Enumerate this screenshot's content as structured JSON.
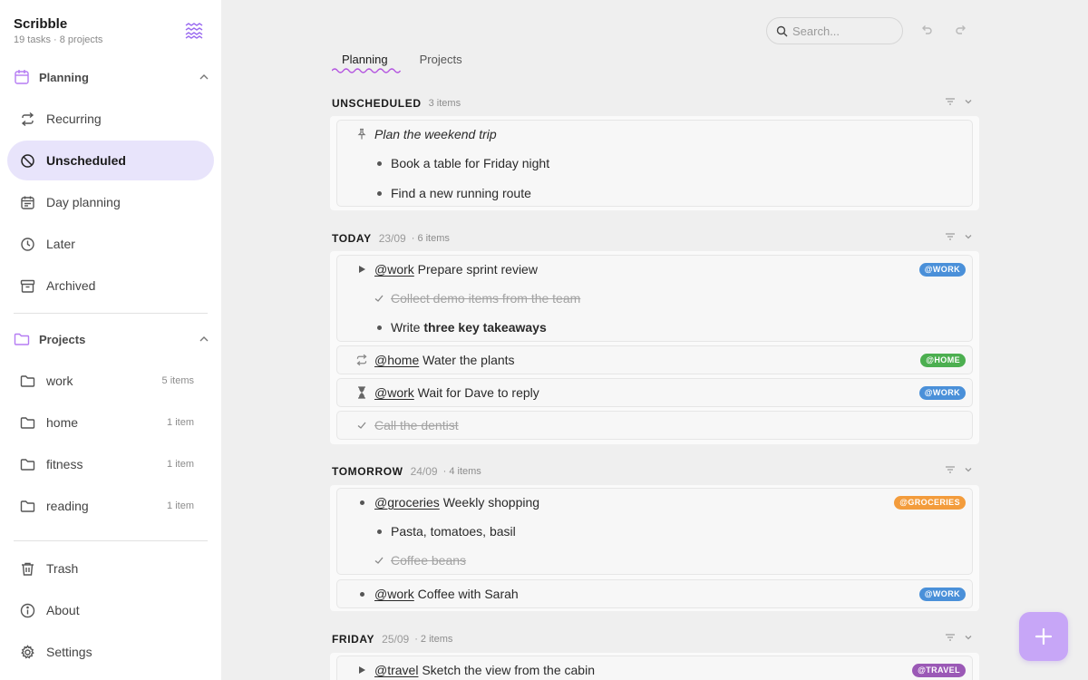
{
  "app": {
    "name": "Scribble",
    "summary": "19 tasks · 8 projects"
  },
  "sidebar": {
    "planning_label": "Planning",
    "planning_items": [
      {
        "label": "Recurring",
        "icon": "repeat-icon"
      },
      {
        "label": "Unscheduled",
        "icon": "unscheduled-icon",
        "active": true
      },
      {
        "label": "Day planning",
        "icon": "calendar-icon"
      },
      {
        "label": "Later",
        "icon": "clock-icon"
      },
      {
        "label": "Archived",
        "icon": "archive-icon"
      }
    ],
    "projects_label": "Projects",
    "projects": [
      {
        "label": "work",
        "count": "5 items"
      },
      {
        "label": "home",
        "count": "1 item"
      },
      {
        "label": "fitness",
        "count": "1 item"
      },
      {
        "label": "reading",
        "count": "1 item"
      }
    ],
    "footer": [
      {
        "label": "Trash",
        "icon": "trash-icon"
      },
      {
        "label": "About",
        "icon": "info-icon"
      },
      {
        "label": "Settings",
        "icon": "gear-icon"
      }
    ]
  },
  "topbar": {
    "search_placeholder": "Search..."
  },
  "tabs": [
    {
      "label": "Planning",
      "active": true
    },
    {
      "label": "Projects"
    }
  ],
  "colors": {
    "accent": "#c084fc",
    "active_bg": "#e8e4fb",
    "work": "#4a90d9",
    "home": "#4caf50",
    "groceries": "#f39c3c",
    "travel": "#9b59b6"
  },
  "sections": {
    "unscheduled": {
      "title": "UNSCHEDULED",
      "count": "3 items",
      "items": [
        {
          "text": "Plan the weekend trip"
        },
        {
          "text": "Book a table for Friday night"
        },
        {
          "text": "Find a new running route"
        }
      ]
    },
    "today": {
      "title": "TODAY",
      "date": "23/09",
      "count": "· 6 items",
      "items": [
        {
          "mention": "@work",
          "text": "Prepare sprint review",
          "tag": "@WORK"
        },
        {
          "text": "Collect demo items from the team"
        },
        {
          "text_prefix": "Write",
          "text_bold": "three key takeaways"
        },
        {
          "mention": "@home",
          "text": "Water the plants",
          "tag": "@HOME"
        },
        {
          "mention": "@work",
          "text": "Wait for Dave to reply",
          "tag": "@WORK"
        },
        {
          "text": "Call the dentist"
        }
      ]
    },
    "tomorrow": {
      "title": "TOMORROW",
      "date": "24/09",
      "count": "· 4 items",
      "items": [
        {
          "mention": "@groceries",
          "text": "Weekly shopping",
          "tag": "@GROCERIES"
        },
        {
          "text": "Pasta, tomatoes, basil"
        },
        {
          "text": "Coffee beans"
        },
        {
          "mention": "@work",
          "text": "Coffee with Sarah",
          "tag": "@WORK"
        }
      ]
    },
    "friday": {
      "title": "FRIDAY",
      "date": "25/09",
      "count": "· 2 items",
      "items": [
        {
          "mention": "@travel",
          "text": "Sketch the view from the cabin",
          "tag": "@TRAVEL"
        }
      ]
    }
  }
}
